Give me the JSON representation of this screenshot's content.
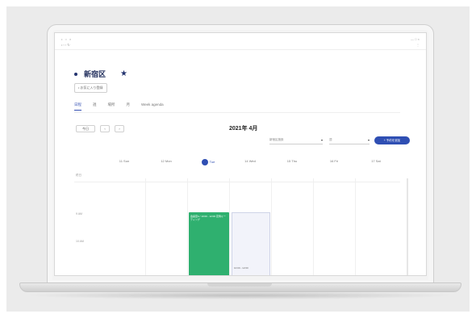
{
  "browser": {
    "tab_text": "• ○ ×",
    "address": "• ‹ › ↻",
    "window_buttons": "— □ ×",
    "menu": "⋮"
  },
  "page": {
    "title": "新宿区",
    "favorite_label": "• お気に入り登録"
  },
  "tabs": [
    {
      "label": "日程",
      "active": true
    },
    {
      "label": "週",
      "active": false
    },
    {
      "label": "場所",
      "active": false
    },
    {
      "label": "月",
      "active": false
    },
    {
      "label": "Week agenda",
      "active": false
    }
  ],
  "toolbar": {
    "today_label": "今日",
    "prev_label": "‹",
    "next_label": "›",
    "period": "2021年 4月",
    "select1_value": "新宿区施設",
    "select2_value": "週",
    "new_button": "+ 予約を追加"
  },
  "days": [
    {
      "label": "11 Sun"
    },
    {
      "label": "12 Mon"
    },
    {
      "label": "Tue",
      "number": "13",
      "today": true
    },
    {
      "label": "14 Wed"
    },
    {
      "label": "15 Thu"
    },
    {
      "label": "16 Fri"
    },
    {
      "label": "17 Sat"
    }
  ],
  "times": [
    "終日",
    "9 AM",
    "10 AM"
  ],
  "events": [
    {
      "title": "会議室A / 10:00 - 12:00 定例ミーティング"
    },
    {
      "title": "10:00 - 12:00"
    }
  ],
  "colors": {
    "accent": "#2f4fb3",
    "event_green": "#2fb06f",
    "title_navy": "#1e2b5a"
  }
}
